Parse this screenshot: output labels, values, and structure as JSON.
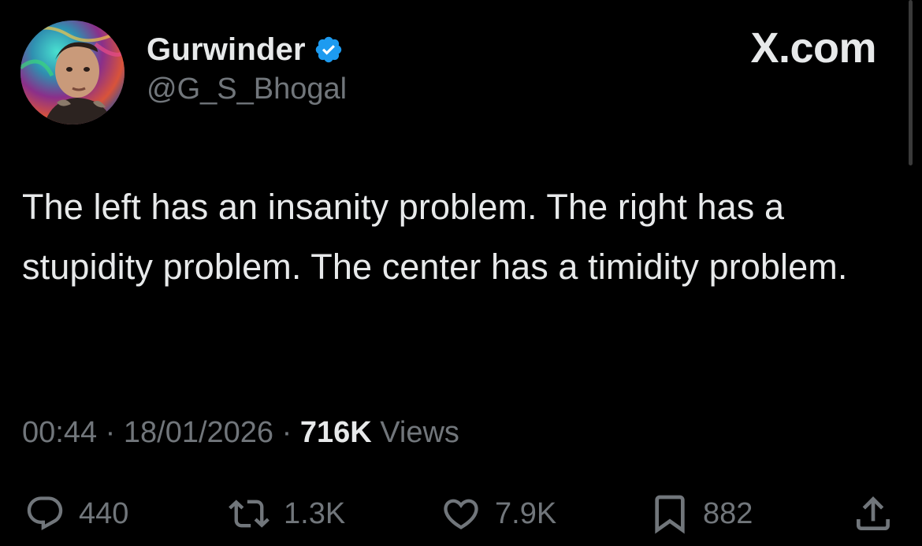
{
  "author": {
    "display_name": "Gurwinder",
    "handle": "@G_S_Bhogal",
    "verified_icon": "verified-badge-icon",
    "avatar_icon": "profile-photo"
  },
  "brand": {
    "label": "X.com"
  },
  "tweet": {
    "text": "The left has an insanity problem. The right has a stupidity problem. The center has a timidity problem."
  },
  "meta": {
    "time": "00:44",
    "separator": "·",
    "date": "18/01/2026",
    "views_count": "716K",
    "views_label": "Views"
  },
  "actions": {
    "replies": "440",
    "reposts": "1.3K",
    "likes": "7.9K",
    "bookmarks": "882"
  },
  "colors": {
    "background": "#000000",
    "primary_text": "#e7e9ea",
    "secondary_text": "#71767b",
    "verified_blue": "#1d9bf0"
  }
}
